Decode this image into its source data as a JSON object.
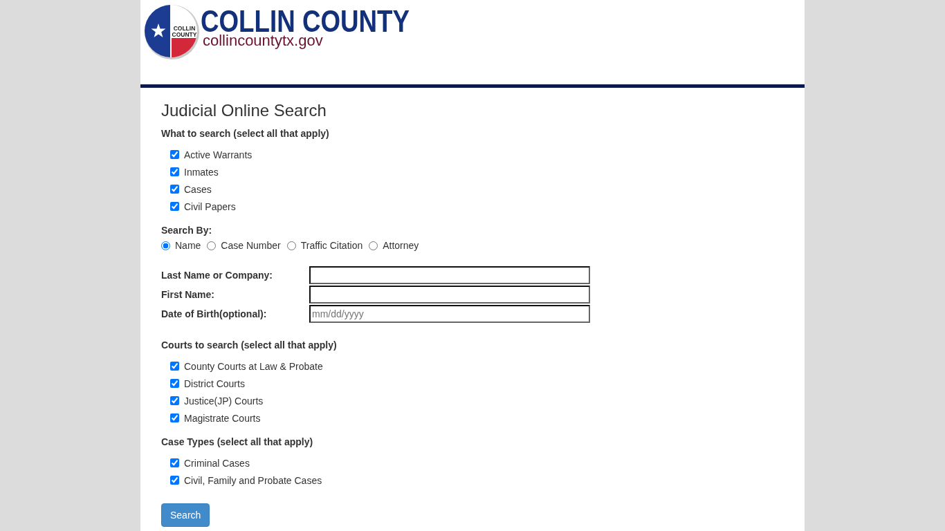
{
  "header": {
    "seal_text": [
      "COLLIN",
      "COUNTY"
    ],
    "name": "COLLIN COUNTY",
    "website": "collincountytx.gov"
  },
  "page_title": "Judicial Online Search",
  "sections": [
    {
      "kind": "checkboxes",
      "heading": "What to search (select all that apply)",
      "options": [
        {
          "label": "Active Warrants",
          "checked": true
        },
        {
          "label": "Inmates",
          "checked": true
        },
        {
          "label": "Cases",
          "checked": true
        },
        {
          "label": "Civil Papers",
          "checked": true
        }
      ]
    },
    {
      "kind": "radios",
      "heading": "Search By:",
      "options": [
        {
          "label": "Name",
          "selected": true
        },
        {
          "label": "Case Number",
          "selected": false
        },
        {
          "label": "Traffic Citation",
          "selected": false
        },
        {
          "label": "Attorney",
          "selected": false
        }
      ]
    },
    {
      "kind": "fields",
      "fields": [
        {
          "label": "Last Name or Company:"
        },
        {
          "label": "First Name:"
        },
        {
          "label": "Date of Birth(optional):",
          "placeholder": "mm/dd/yyyy"
        }
      ]
    },
    {
      "kind": "checkboxes",
      "heading": "Courts to search (select all that apply)",
      "options": [
        {
          "label": "County Courts at Law & Probate",
          "checked": true
        },
        {
          "label": "District Courts",
          "checked": true
        },
        {
          "label": "Justice(JP) Courts",
          "checked": true
        },
        {
          "label": "Magistrate Courts",
          "checked": true
        }
      ]
    },
    {
      "kind": "checkboxes",
      "heading": "Case Types (select all that apply)",
      "options": [
        {
          "label": "Criminal Cases",
          "checked": true
        },
        {
          "label": "Civil, Family and Probate Cases",
          "checked": true
        }
      ]
    }
  ],
  "search_button": "Search"
}
